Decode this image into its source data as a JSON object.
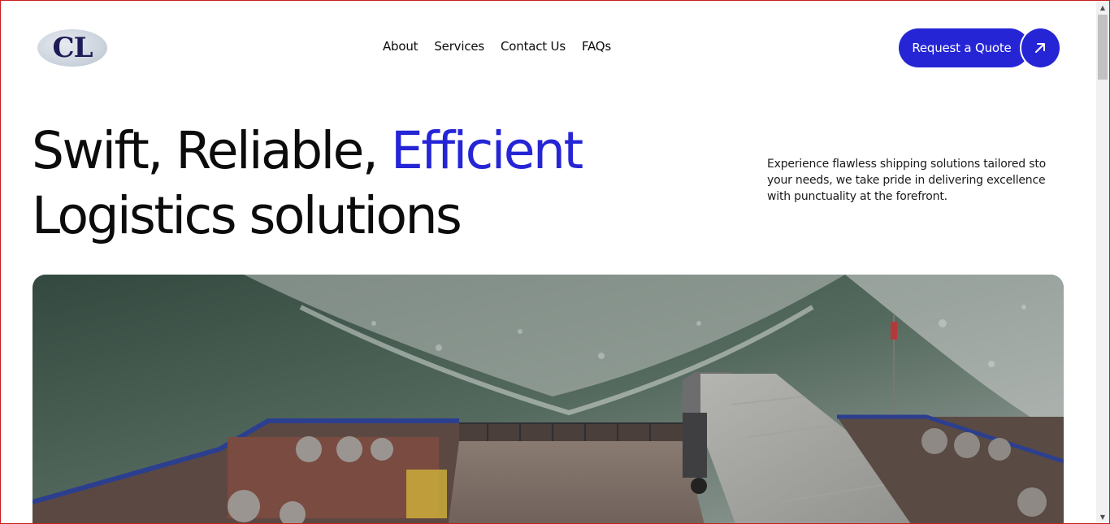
{
  "brand": {
    "logo_text": "CL",
    "logo_name": "cl-logo"
  },
  "nav": [
    {
      "label": "About"
    },
    {
      "label": "Services"
    },
    {
      "label": "Contact Us"
    },
    {
      "label": "FAQs"
    }
  ],
  "cta": {
    "label": "Request a Quote",
    "icon": "arrow-up-right-icon"
  },
  "hero": {
    "headline_part1": "Swift, Reliable, ",
    "headline_accent": "Efficient",
    "headline_part2": "Logistics solutions",
    "intro": "Experience flawless shipping solutions tailored sto your needs, we take pride in delivering excellence with punctuality at the forefront."
  },
  "colors": {
    "accent": "#2525d6",
    "text": "#0c0c0c",
    "background": "#ffffff",
    "frame": "#c81e1e"
  }
}
